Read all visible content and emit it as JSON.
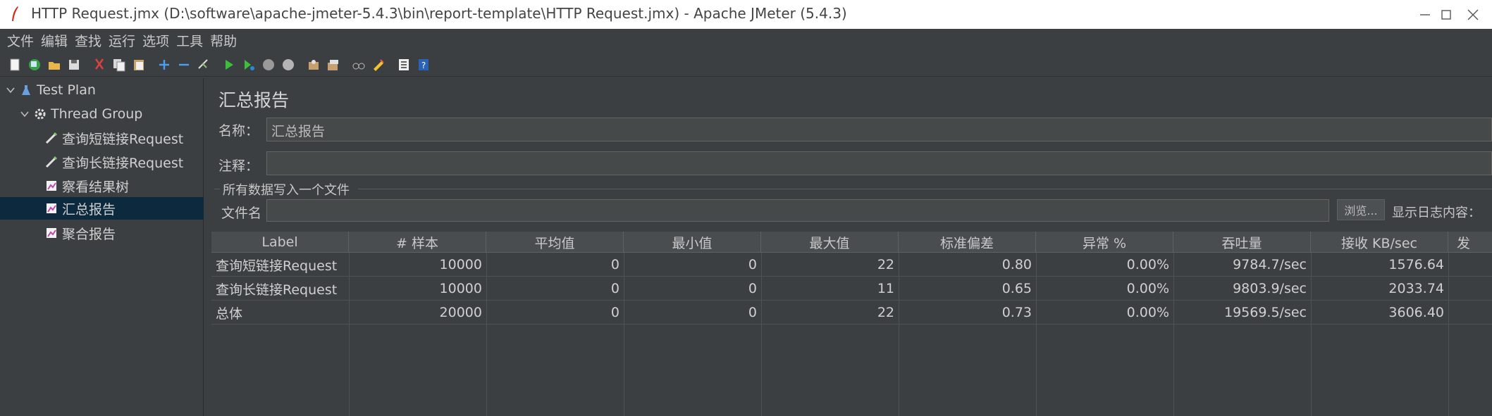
{
  "window": {
    "title": "HTTP Request.jmx (D:\\software\\apache-jmeter-5.4.3\\bin\\report-template\\HTTP Request.jmx) - Apache JMeter (5.4.3)"
  },
  "menu": [
    "文件",
    "编辑",
    "查找",
    "运行",
    "选项",
    "工具",
    "帮助"
  ],
  "toolbar_icons": [
    "new-icon",
    "templates-icon",
    "open-icon",
    "save-icon",
    "cut-icon",
    "copy-icon",
    "paste-icon",
    "expand-icon",
    "collapse-icon",
    "toggle-icon",
    "start-icon",
    "start-no-pause-icon",
    "stop-icon",
    "shutdown-icon",
    "clear-icon",
    "clear-all-icon",
    "search-icon",
    "reset-search-icon",
    "function-helper-icon",
    "help-icon"
  ],
  "tree": [
    {
      "label": "Test Plan",
      "icon": "test-plan-icon"
    },
    {
      "label": "Thread Group",
      "icon": "gear-icon"
    },
    {
      "label": "查询短链接Request",
      "icon": "sampler-icon"
    },
    {
      "label": "查询长链接Request",
      "icon": "sampler-icon"
    },
    {
      "label": "察看结果树",
      "icon": "listener-icon"
    },
    {
      "label": "汇总报告",
      "icon": "listener-icon"
    },
    {
      "label": "聚合报告",
      "icon": "listener-icon"
    }
  ],
  "pane": {
    "title": "汇总报告",
    "name_label": "名称：",
    "name_value": "汇总报告",
    "comment_label": "注释：",
    "comment_value": "",
    "fieldset_title": "所有数据写入一个文件",
    "filename_label": "文件名",
    "filename_value": "",
    "browse_label": "浏览...",
    "log_label": "显示日志内容："
  },
  "table": {
    "columns": [
      "Label",
      "# 样本",
      "平均值",
      "最小值",
      "最大值",
      "标准偏差",
      "异常 %",
      "吞吐量",
      "接收 KB/sec",
      "发"
    ],
    "rows": [
      [
        "查询短链接Request",
        "10000",
        "0",
        "0",
        "22",
        "0.80",
        "0.00%",
        "9784.7/sec",
        "1576.64"
      ],
      [
        "查询长链接Request",
        "10000",
        "0",
        "0",
        "11",
        "0.65",
        "0.00%",
        "9803.9/sec",
        "2033.74"
      ],
      [
        "总体",
        "20000",
        "0",
        "0",
        "22",
        "0.73",
        "0.00%",
        "19569.5/sec",
        "3606.40"
      ]
    ]
  },
  "colors": {
    "background": "#3c3f41",
    "selection": "#0d293e",
    "header": "#4a4d50"
  }
}
